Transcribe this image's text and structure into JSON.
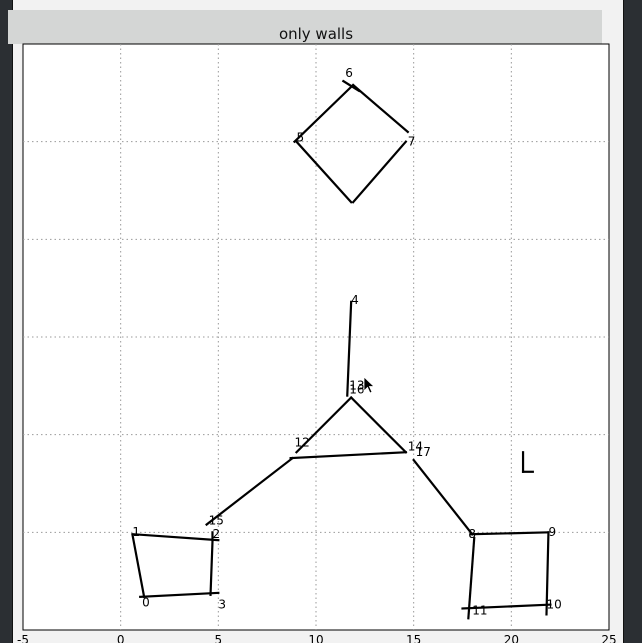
{
  "window": {
    "title": "only walls"
  },
  "chart_data": {
    "type": "line",
    "title": "only walls",
    "xlim": [
      -5,
      25
    ],
    "ylim": [
      -10,
      20
    ],
    "xticks": [
      -5,
      0,
      5,
      10,
      15,
      20,
      25
    ],
    "yticks": [
      -10,
      -5,
      0,
      5,
      10,
      15,
      20
    ],
    "xtick_labels": [
      "-5",
      "0",
      "5",
      "10",
      "15",
      "20",
      "25"
    ],
    "grid": true,
    "nodes": [
      {
        "label": "0",
        "x": 1.1,
        "y": -8.8
      },
      {
        "label": "1",
        "x": 0.6,
        "y": -5.2
      },
      {
        "label": "2",
        "x": 4.7,
        "y": -5.3
      },
      {
        "label": "3",
        "x": 5.0,
        "y": -8.9
      },
      {
        "label": "4",
        "x": 11.8,
        "y": 6.7
      },
      {
        "label": "5",
        "x": 9.0,
        "y": 15.0
      },
      {
        "label": "6",
        "x": 11.5,
        "y": 18.3
      },
      {
        "label": "7",
        "x": 14.7,
        "y": 14.8
      },
      {
        "label": "8",
        "x": 17.8,
        "y": -5.3
      },
      {
        "label": "9",
        "x": 21.9,
        "y": -5.2
      },
      {
        "label": "10",
        "x": 21.8,
        "y": -8.9
      },
      {
        "label": "11",
        "x": 18.0,
        "y": -9.2
      },
      {
        "label": "12",
        "x": 8.9,
        "y": -0.6
      },
      {
        "label": "13",
        "x": 11.7,
        "y": 2.3
      },
      {
        "label": "14",
        "x": 14.7,
        "y": -0.8
      },
      {
        "label": "15",
        "x": 4.5,
        "y": -4.6
      },
      {
        "label": "16",
        "x": 11.7,
        "y": 2.1
      },
      {
        "label": "17",
        "x": 15.1,
        "y": -1.1
      }
    ],
    "walls": [
      [
        [
          0.6,
          -5.1
        ],
        [
          1.2,
          -8.3
        ]
      ],
      [
        [
          1.0,
          -8.3
        ],
        [
          5.0,
          -8.1
        ]
      ],
      [
        [
          4.7,
          -5.5
        ],
        [
          4.6,
          -8.2
        ]
      ],
      [
        [
          0.7,
          -5.1
        ],
        [
          5.0,
          -5.4
        ]
      ],
      [
        [
          4.7,
          -5.4
        ],
        [
          4.7,
          -5.0
        ]
      ],
      [
        [
          4.4,
          -4.6
        ],
        [
          8.8,
          -1.2
        ]
      ],
      [
        [
          8.7,
          -1.2
        ],
        [
          14.6,
          -0.9
        ]
      ],
      [
        [
          9.0,
          -0.9
        ],
        [
          11.8,
          1.9
        ]
      ],
      [
        [
          11.8,
          1.9
        ],
        [
          14.6,
          -0.9
        ]
      ],
      [
        [
          11.6,
          2.0
        ],
        [
          11.8,
          6.8
        ]
      ],
      [
        [
          15.0,
          -1.3
        ],
        [
          18.0,
          -5.1
        ]
      ],
      [
        [
          17.9,
          -5.1
        ],
        [
          21.9,
          -5.0
        ]
      ],
      [
        [
          18.1,
          -5.3
        ],
        [
          17.8,
          -9.4
        ]
      ],
      [
        [
          21.9,
          -5.0
        ],
        [
          21.8,
          -9.2
        ]
      ],
      [
        [
          17.5,
          -8.9
        ],
        [
          22.0,
          -8.7
        ]
      ],
      [
        [
          9.0,
          15.0
        ],
        [
          11.8,
          11.9
        ]
      ],
      [
        [
          11.9,
          11.9
        ],
        [
          14.6,
          15.0
        ]
      ],
      [
        [
          8.9,
          15.0
        ],
        [
          11.9,
          17.9
        ]
      ],
      [
        [
          11.9,
          17.9
        ],
        [
          14.7,
          15.5
        ]
      ],
      [
        [
          11.4,
          18.1
        ],
        [
          12.2,
          17.6
        ]
      ],
      [
        [
          20.6,
          -0.9
        ],
        [
          20.6,
          -1.9
        ]
      ],
      [
        [
          20.6,
          -1.9
        ],
        [
          21.1,
          -1.9
        ]
      ]
    ]
  }
}
